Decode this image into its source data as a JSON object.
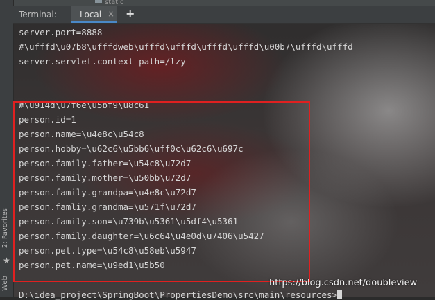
{
  "project_tree": {
    "folder_label": "static"
  },
  "side_tabs": {
    "favorites": "2: Favorites",
    "web": "Web"
  },
  "tool_window": {
    "title": "Terminal:",
    "tabs": [
      {
        "label": "Local",
        "active": true
      }
    ],
    "add_tab_symbol": "+",
    "close_symbol": "×"
  },
  "terminal": {
    "lines": [
      "server.port=8888",
      "#\\ufffd\\u07b8\\ufffdweb\\ufffd\\ufffd\\ufffd\\ufffd\\u00b7\\ufffd\\ufffd",
      "server.servlet.context-path=/lzy",
      "",
      "",
      "#\\u914d\\u7f6e\\u5bf9\\u8c61",
      "person.id=1",
      "person.name=\\u4e8c\\u54c8",
      "person.hobby=\\u62c6\\u5bb6\\uff0c\\u62c6\\u697c",
      "person.family.father=\\u54c8\\u72d7",
      "person.family.mother=\\u50bb\\u72d7",
      "person.family.grandpa=\\u4e8c\\u72d7",
      "person.famliy.grandma=\\u571f\\u72d7",
      "person.family.son=\\u739b\\u5361\\u5df4\\u5361",
      "person.family.daughter=\\u6c64\\u4e0d\\u7406\\u5427",
      "person.pet.type=\\u54c8\\u58eb\\u5947",
      "person.pet.name=\\u9ed1\\u5b50"
    ],
    "prompt": "D:\\idea_project\\SpringBoot\\PropertiesDemo\\src\\main\\resources>"
  },
  "watermark": "https://blog.csdn.net/doubleview",
  "colors": {
    "highlight_box": "#e02020",
    "terminal_text": "#d6d6d6",
    "active_tab_underline": "#4a88c7"
  }
}
